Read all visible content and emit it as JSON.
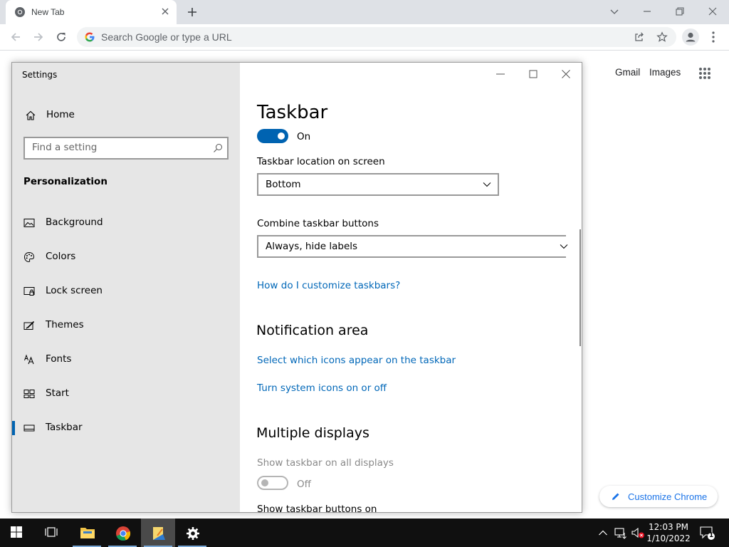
{
  "browser": {
    "tab_title": "New Tab",
    "omnibox_placeholder": "Search Google or type a URL",
    "ntp": {
      "gmail": "Gmail",
      "images": "Images",
      "customize": "Customize Chrome"
    }
  },
  "settings": {
    "window_title": "Settings",
    "home": "Home",
    "search_placeholder": "Find a setting",
    "section": "Personalization",
    "nav": [
      {
        "label": "Background",
        "icon": "picture-icon"
      },
      {
        "label": "Colors",
        "icon": "palette-icon"
      },
      {
        "label": "Lock screen",
        "icon": "lock-screen-icon"
      },
      {
        "label": "Themes",
        "icon": "brush-icon"
      },
      {
        "label": "Fonts",
        "icon": "font-icon"
      },
      {
        "label": "Start",
        "icon": "start-icon"
      },
      {
        "label": "Taskbar",
        "icon": "taskbar-icon",
        "selected": true
      }
    ],
    "page": {
      "title": "Taskbar",
      "top_toggle": {
        "state": "On"
      },
      "location_label": "Taskbar location on screen",
      "location_value": "Bottom",
      "combine_label": "Combine taskbar buttons",
      "combine_value": "Always, hide labels",
      "customize_link": "How do I customize taskbars?",
      "notification_heading": "Notification area",
      "notification_links": [
        "Select which icons appear on the taskbar",
        "Turn system icons on or off"
      ],
      "multiple_heading": "Multiple displays",
      "show_all_label": "Show taskbar on all displays",
      "show_all_state": "Off",
      "show_buttons_label": "Show taskbar buttons on"
    }
  },
  "taskbar": {
    "time": "12:03 PM",
    "date": "1/10/2022",
    "notification_count": "1"
  },
  "colors": {
    "accent": "#0063b1",
    "link": "#0067b8",
    "sidebar_bg": "#e6e6e6",
    "taskbar_bg": "#101010"
  }
}
